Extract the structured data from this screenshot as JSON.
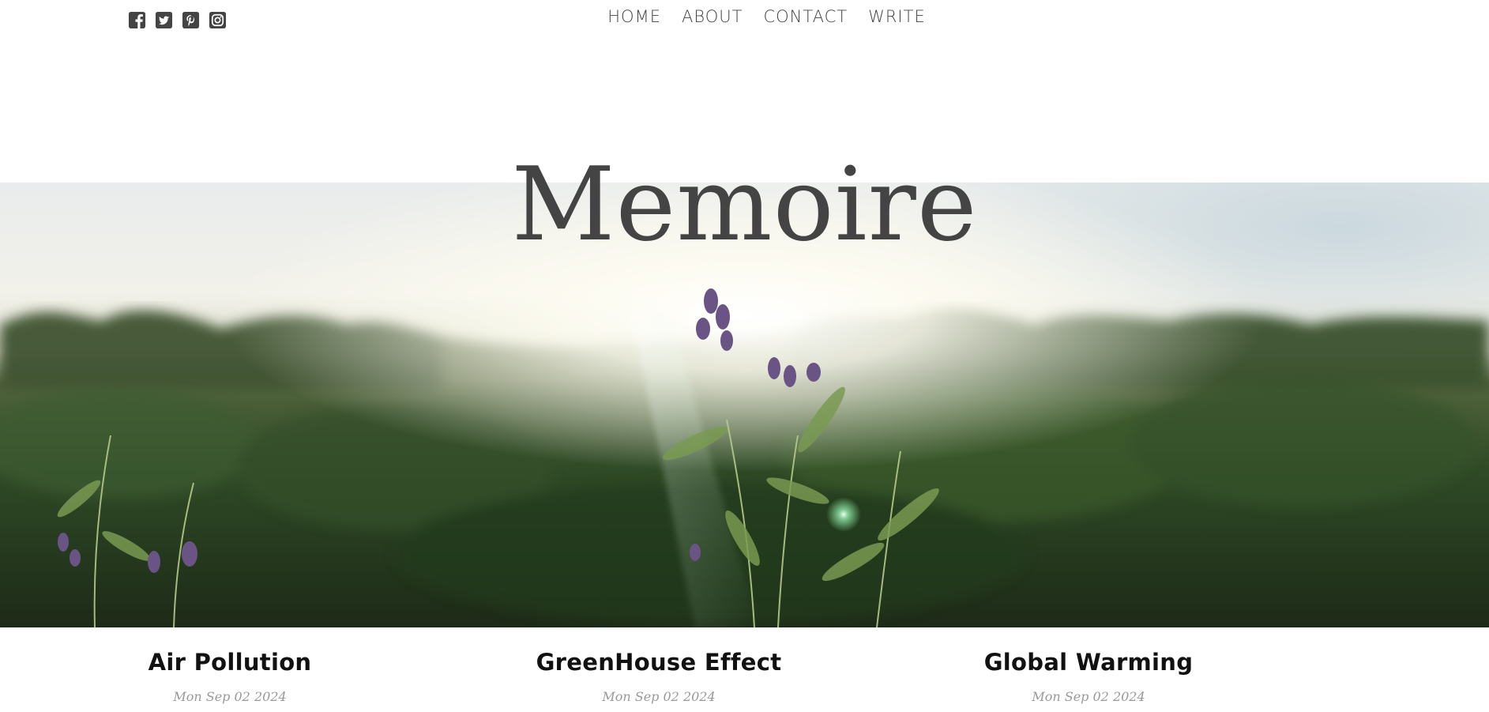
{
  "social": {
    "icons": [
      "facebook-square-icon",
      "twitter-square-icon",
      "pinterest-square-icon",
      "instagram-icon"
    ],
    "icon_color": "#444444"
  },
  "nav": {
    "items": [
      "HOME",
      "ABOUT",
      "CONTACT",
      "WRITE"
    ]
  },
  "header": {
    "title": "Memoire"
  },
  "hero": {
    "image": "sunlit-field-with-purple-wildflowers"
  },
  "posts": [
    {
      "title": "Air Pollution",
      "date": "Mon Sep 02 2024"
    },
    {
      "title": "GreenHouse Effect",
      "date": "Mon Sep 02 2024"
    },
    {
      "title": "Global Warming",
      "date": "Mon Sep 02 2024"
    }
  ],
  "colors": {
    "text": "#444444",
    "post_title": "#111111",
    "post_date": "#999999"
  }
}
